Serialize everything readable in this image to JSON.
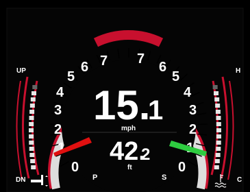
{
  "speed": {
    "value_int": "15.",
    "value_dec": "1",
    "unit": "mph"
  },
  "depth": {
    "value_int": "42.",
    "value_dec": "2",
    "unit": "ft"
  },
  "left_scale": {
    "top": "UP",
    "bottom": "DN",
    "left_labels": [
      "7",
      "6",
      "5",
      "4",
      "3",
      "2",
      "1",
      "0"
    ],
    "port_label": "P"
  },
  "right_scale": {
    "top": "H",
    "bottom": "C",
    "right_labels": [
      "7",
      "6",
      "5",
      "4",
      "3",
      "2",
      "1",
      "0"
    ],
    "stbd_label": "S"
  },
  "colors": {
    "accent_red": "#c8102e",
    "port_red": "#e01010",
    "stbd_green": "#2ecc40"
  },
  "icons": {
    "trim": "trim-icon",
    "temp": "water-temp-icon"
  }
}
